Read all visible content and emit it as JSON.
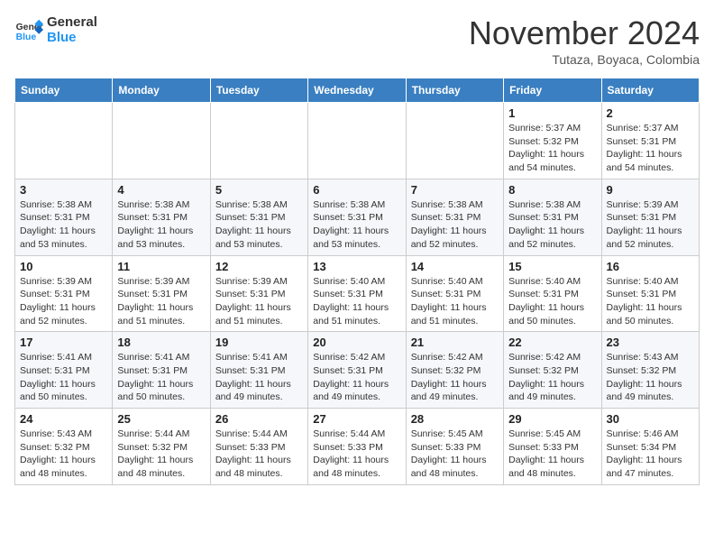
{
  "header": {
    "logo_general": "General",
    "logo_blue": "Blue",
    "month_title": "November 2024",
    "location": "Tutaza, Boyaca, Colombia"
  },
  "columns": [
    "Sunday",
    "Monday",
    "Tuesday",
    "Wednesday",
    "Thursday",
    "Friday",
    "Saturday"
  ],
  "weeks": [
    [
      {
        "day": "",
        "info": ""
      },
      {
        "day": "",
        "info": ""
      },
      {
        "day": "",
        "info": ""
      },
      {
        "day": "",
        "info": ""
      },
      {
        "day": "",
        "info": ""
      },
      {
        "day": "1",
        "info": "Sunrise: 5:37 AM\nSunset: 5:32 PM\nDaylight: 11 hours and 54 minutes."
      },
      {
        "day": "2",
        "info": "Sunrise: 5:37 AM\nSunset: 5:31 PM\nDaylight: 11 hours and 54 minutes."
      }
    ],
    [
      {
        "day": "3",
        "info": "Sunrise: 5:38 AM\nSunset: 5:31 PM\nDaylight: 11 hours and 53 minutes."
      },
      {
        "day": "4",
        "info": "Sunrise: 5:38 AM\nSunset: 5:31 PM\nDaylight: 11 hours and 53 minutes."
      },
      {
        "day": "5",
        "info": "Sunrise: 5:38 AM\nSunset: 5:31 PM\nDaylight: 11 hours and 53 minutes."
      },
      {
        "day": "6",
        "info": "Sunrise: 5:38 AM\nSunset: 5:31 PM\nDaylight: 11 hours and 53 minutes."
      },
      {
        "day": "7",
        "info": "Sunrise: 5:38 AM\nSunset: 5:31 PM\nDaylight: 11 hours and 52 minutes."
      },
      {
        "day": "8",
        "info": "Sunrise: 5:38 AM\nSunset: 5:31 PM\nDaylight: 11 hours and 52 minutes."
      },
      {
        "day": "9",
        "info": "Sunrise: 5:39 AM\nSunset: 5:31 PM\nDaylight: 11 hours and 52 minutes."
      }
    ],
    [
      {
        "day": "10",
        "info": "Sunrise: 5:39 AM\nSunset: 5:31 PM\nDaylight: 11 hours and 52 minutes."
      },
      {
        "day": "11",
        "info": "Sunrise: 5:39 AM\nSunset: 5:31 PM\nDaylight: 11 hours and 51 minutes."
      },
      {
        "day": "12",
        "info": "Sunrise: 5:39 AM\nSunset: 5:31 PM\nDaylight: 11 hours and 51 minutes."
      },
      {
        "day": "13",
        "info": "Sunrise: 5:40 AM\nSunset: 5:31 PM\nDaylight: 11 hours and 51 minutes."
      },
      {
        "day": "14",
        "info": "Sunrise: 5:40 AM\nSunset: 5:31 PM\nDaylight: 11 hours and 51 minutes."
      },
      {
        "day": "15",
        "info": "Sunrise: 5:40 AM\nSunset: 5:31 PM\nDaylight: 11 hours and 50 minutes."
      },
      {
        "day": "16",
        "info": "Sunrise: 5:40 AM\nSunset: 5:31 PM\nDaylight: 11 hours and 50 minutes."
      }
    ],
    [
      {
        "day": "17",
        "info": "Sunrise: 5:41 AM\nSunset: 5:31 PM\nDaylight: 11 hours and 50 minutes."
      },
      {
        "day": "18",
        "info": "Sunrise: 5:41 AM\nSunset: 5:31 PM\nDaylight: 11 hours and 50 minutes."
      },
      {
        "day": "19",
        "info": "Sunrise: 5:41 AM\nSunset: 5:31 PM\nDaylight: 11 hours and 49 minutes."
      },
      {
        "day": "20",
        "info": "Sunrise: 5:42 AM\nSunset: 5:31 PM\nDaylight: 11 hours and 49 minutes."
      },
      {
        "day": "21",
        "info": "Sunrise: 5:42 AM\nSunset: 5:32 PM\nDaylight: 11 hours and 49 minutes."
      },
      {
        "day": "22",
        "info": "Sunrise: 5:42 AM\nSunset: 5:32 PM\nDaylight: 11 hours and 49 minutes."
      },
      {
        "day": "23",
        "info": "Sunrise: 5:43 AM\nSunset: 5:32 PM\nDaylight: 11 hours and 49 minutes."
      }
    ],
    [
      {
        "day": "24",
        "info": "Sunrise: 5:43 AM\nSunset: 5:32 PM\nDaylight: 11 hours and 48 minutes."
      },
      {
        "day": "25",
        "info": "Sunrise: 5:44 AM\nSunset: 5:32 PM\nDaylight: 11 hours and 48 minutes."
      },
      {
        "day": "26",
        "info": "Sunrise: 5:44 AM\nSunset: 5:33 PM\nDaylight: 11 hours and 48 minutes."
      },
      {
        "day": "27",
        "info": "Sunrise: 5:44 AM\nSunset: 5:33 PM\nDaylight: 11 hours and 48 minutes."
      },
      {
        "day": "28",
        "info": "Sunrise: 5:45 AM\nSunset: 5:33 PM\nDaylight: 11 hours and 48 minutes."
      },
      {
        "day": "29",
        "info": "Sunrise: 5:45 AM\nSunset: 5:33 PM\nDaylight: 11 hours and 48 minutes."
      },
      {
        "day": "30",
        "info": "Sunrise: 5:46 AM\nSunset: 5:34 PM\nDaylight: 11 hours and 47 minutes."
      }
    ]
  ]
}
